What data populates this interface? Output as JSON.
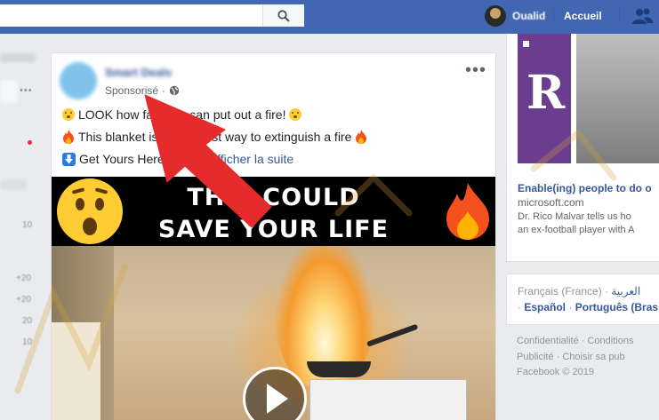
{
  "topbar": {
    "search": {
      "placeholder": "",
      "value": ""
    },
    "user_name": "Oualid",
    "home_label": "Accueil"
  },
  "left": {
    "more": "•••",
    "nums": [
      "10",
      "+20",
      "+20",
      "20",
      "10"
    ]
  },
  "post": {
    "author": "Smart Deals",
    "sponsored": "Sponsorisé",
    "meta_dot": "·",
    "more": "•••",
    "line1": "LOOK how fast you can put out a fire!",
    "line2_before": "This blanket is the best way to extingui",
    "line2": "This blanket is the easiest way to extinguish a fire",
    "line3_text": "Get Yours Here",
    "line3_link": "Afficher la suite",
    "banner": {
      "line1": "THIS COULD",
      "line2": "SAVE YOUR LIFE"
    }
  },
  "ad": {
    "title": "Enable(ing) people to do o",
    "url": "microsoft.com",
    "desc1": "Dr. Rico Malvar tells us ho",
    "desc2": "an ex-football player with A"
  },
  "languages": {
    "current": "Français (France)",
    "arabic": "العربية",
    "spanish": "Español",
    "portuguese": "Português (Brasi"
  },
  "footer": {
    "line1": "Confidentialité · Conditions",
    "line2": "Publicité · Choisir sa pub",
    "line3": "Facebook © 2019"
  },
  "colors": {
    "brand": "#4267b2",
    "link": "#365899",
    "arrow": "#e52b2b"
  }
}
